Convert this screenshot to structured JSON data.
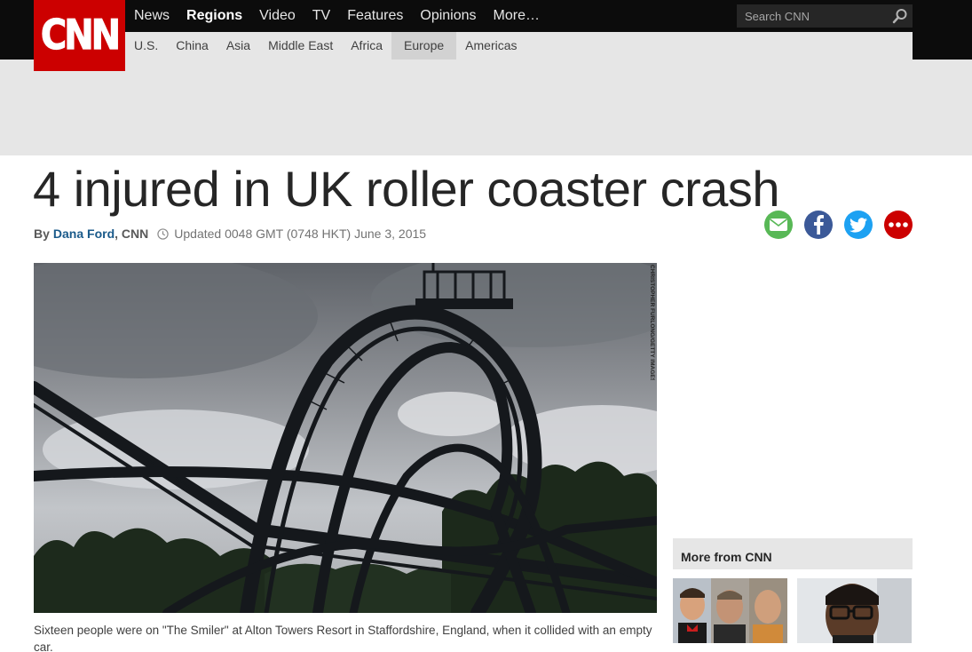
{
  "brand": {
    "logo_text": "CNN",
    "color": "#cc0000"
  },
  "nav": {
    "items": [
      {
        "label": "News"
      },
      {
        "label": "Regions"
      },
      {
        "label": "Video"
      },
      {
        "label": "TV"
      },
      {
        "label": "Features"
      },
      {
        "label": "Opinions"
      },
      {
        "label": "More…"
      }
    ],
    "active": "Regions"
  },
  "search": {
    "placeholder": "Search CNN"
  },
  "subnav": {
    "items": [
      {
        "label": "U.S."
      },
      {
        "label": "China"
      },
      {
        "label": "Asia"
      },
      {
        "label": "Middle East"
      },
      {
        "label": "Africa"
      },
      {
        "label": "Europe"
      },
      {
        "label": "Americas"
      }
    ],
    "active": "Europe"
  },
  "article": {
    "headline": "4 injured in UK roller coaster crash",
    "byline_prefix": "By",
    "author": "Dana Ford",
    "author_org": ", CNN",
    "updated": "Updated 0048 GMT (0748 HKT) June 3, 2015",
    "image_credit": "CHRISTOPHER FURLONG/GETTY IMAGES",
    "caption": "Sixteen people were on \"The Smiler\" at Alton Towers Resort in Staffordshire, England, when it collided with an empty car."
  },
  "share": {
    "buttons": [
      {
        "name": "email-share-button",
        "icon": "envelope-icon",
        "color": "#58b856"
      },
      {
        "name": "facebook-share-button",
        "icon": "facebook-icon",
        "color": "#3b5998"
      },
      {
        "name": "twitter-share-button",
        "icon": "twitter-icon",
        "color": "#1da1f2"
      },
      {
        "name": "more-share-button",
        "icon": "more-dots-icon",
        "color": "#cc0000"
      }
    ]
  },
  "sidebar": {
    "more_title": "More from CNN"
  }
}
